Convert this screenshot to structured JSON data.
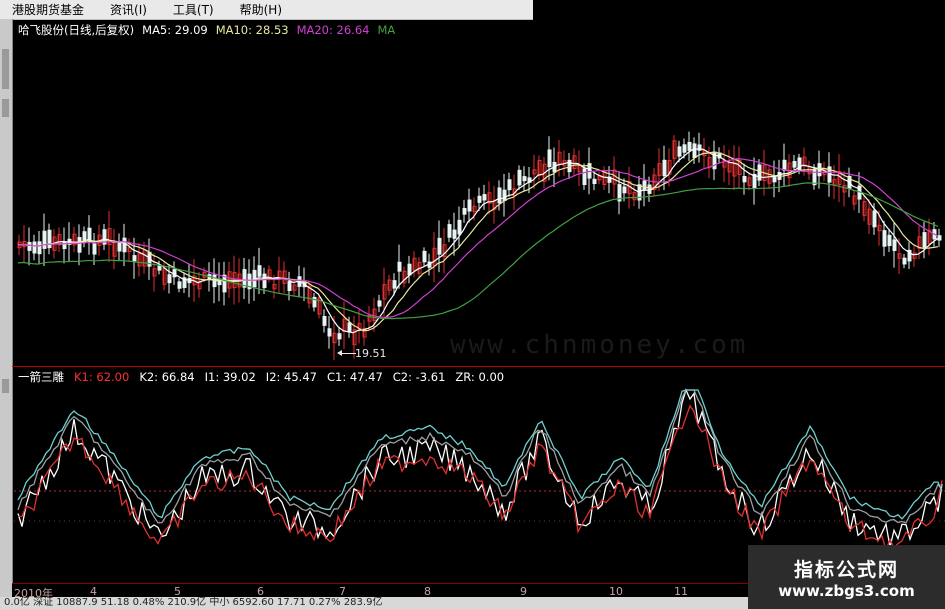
{
  "menu": [
    {
      "label": "港股期货基金",
      "name": "menu-hk-futures-funds"
    },
    {
      "label": "资讯(I)",
      "name": "menu-info"
    },
    {
      "label": "工具(T)",
      "name": "menu-tools"
    },
    {
      "label": "帮助(H)",
      "name": "menu-help"
    }
  ],
  "main_chart": {
    "stock_title": "哈飞股份(日线,后复权)",
    "ma5": "MA5: 29.09",
    "ma10": "MA10: 28.53",
    "ma20": "MA20: 26.64",
    "ma_extra": "MA",
    "low_marker": "19.51"
  },
  "indicator": {
    "name": "一箭三雕",
    "k1": "K1: 62.00",
    "k2": "K2: 66.84",
    "i1": "I1: 39.02",
    "i2": "I2: 45.47",
    "c1": "C1: 47.47",
    "c2": "C2: -3.61",
    "zr": "ZR: 0.00"
  },
  "axis": {
    "year": "2010年",
    "months": [
      "4",
      "5",
      "6",
      "7",
      "8",
      "9",
      "10",
      "11"
    ]
  },
  "status": "0.0亿 深证 10887.9  51.18  0.48%  210.9亿 中小 6592.60  17.71  0.27%  283.9亿",
  "watermark": "www.chnmoney.com",
  "badge": {
    "title": "指标公式网",
    "url": "www.zbgs3.com"
  },
  "colors": {
    "ma5": "#ffffff",
    "ma10": "#e8e8a0",
    "ma20": "#d040d0",
    "ma_extra": "#40a040",
    "up": "#e03030",
    "down": "#60e0e0",
    "k1": "#ff3030",
    "k2": "#ffffff",
    "i1": "#ffff00",
    "i2": "#ff40ff",
    "c1": "#40ff40",
    "c2": "#8080ff",
    "zr": "#ffffff",
    "title": "#ffffff",
    "indicator_name": "#ffffff"
  }
}
